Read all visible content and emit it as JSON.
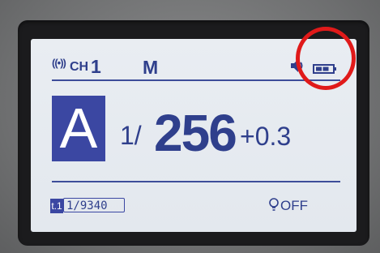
{
  "display": {
    "signal_icon": "((•))",
    "channel_label": "CH",
    "channel_value": "1",
    "mode_top": "M",
    "flash_mode": "A",
    "shutter_fraction": "1/",
    "shutter_value": "256",
    "exposure_comp": "+0.3",
    "sync_badge": "t.1",
    "sync_speed": "1/9340",
    "modeling_light_status": "OFF"
  },
  "icons": {
    "speaker": "speaker-icon",
    "battery": "battery-icon",
    "bulb": "bulb-icon",
    "signal": "wireless-signal-icon"
  },
  "colors": {
    "lcd_text": "#2f3f8c",
    "lcd_background": "#e6ebf0",
    "highlight_box": "#3b47a2",
    "annotation_circle": "#e01a1a"
  }
}
